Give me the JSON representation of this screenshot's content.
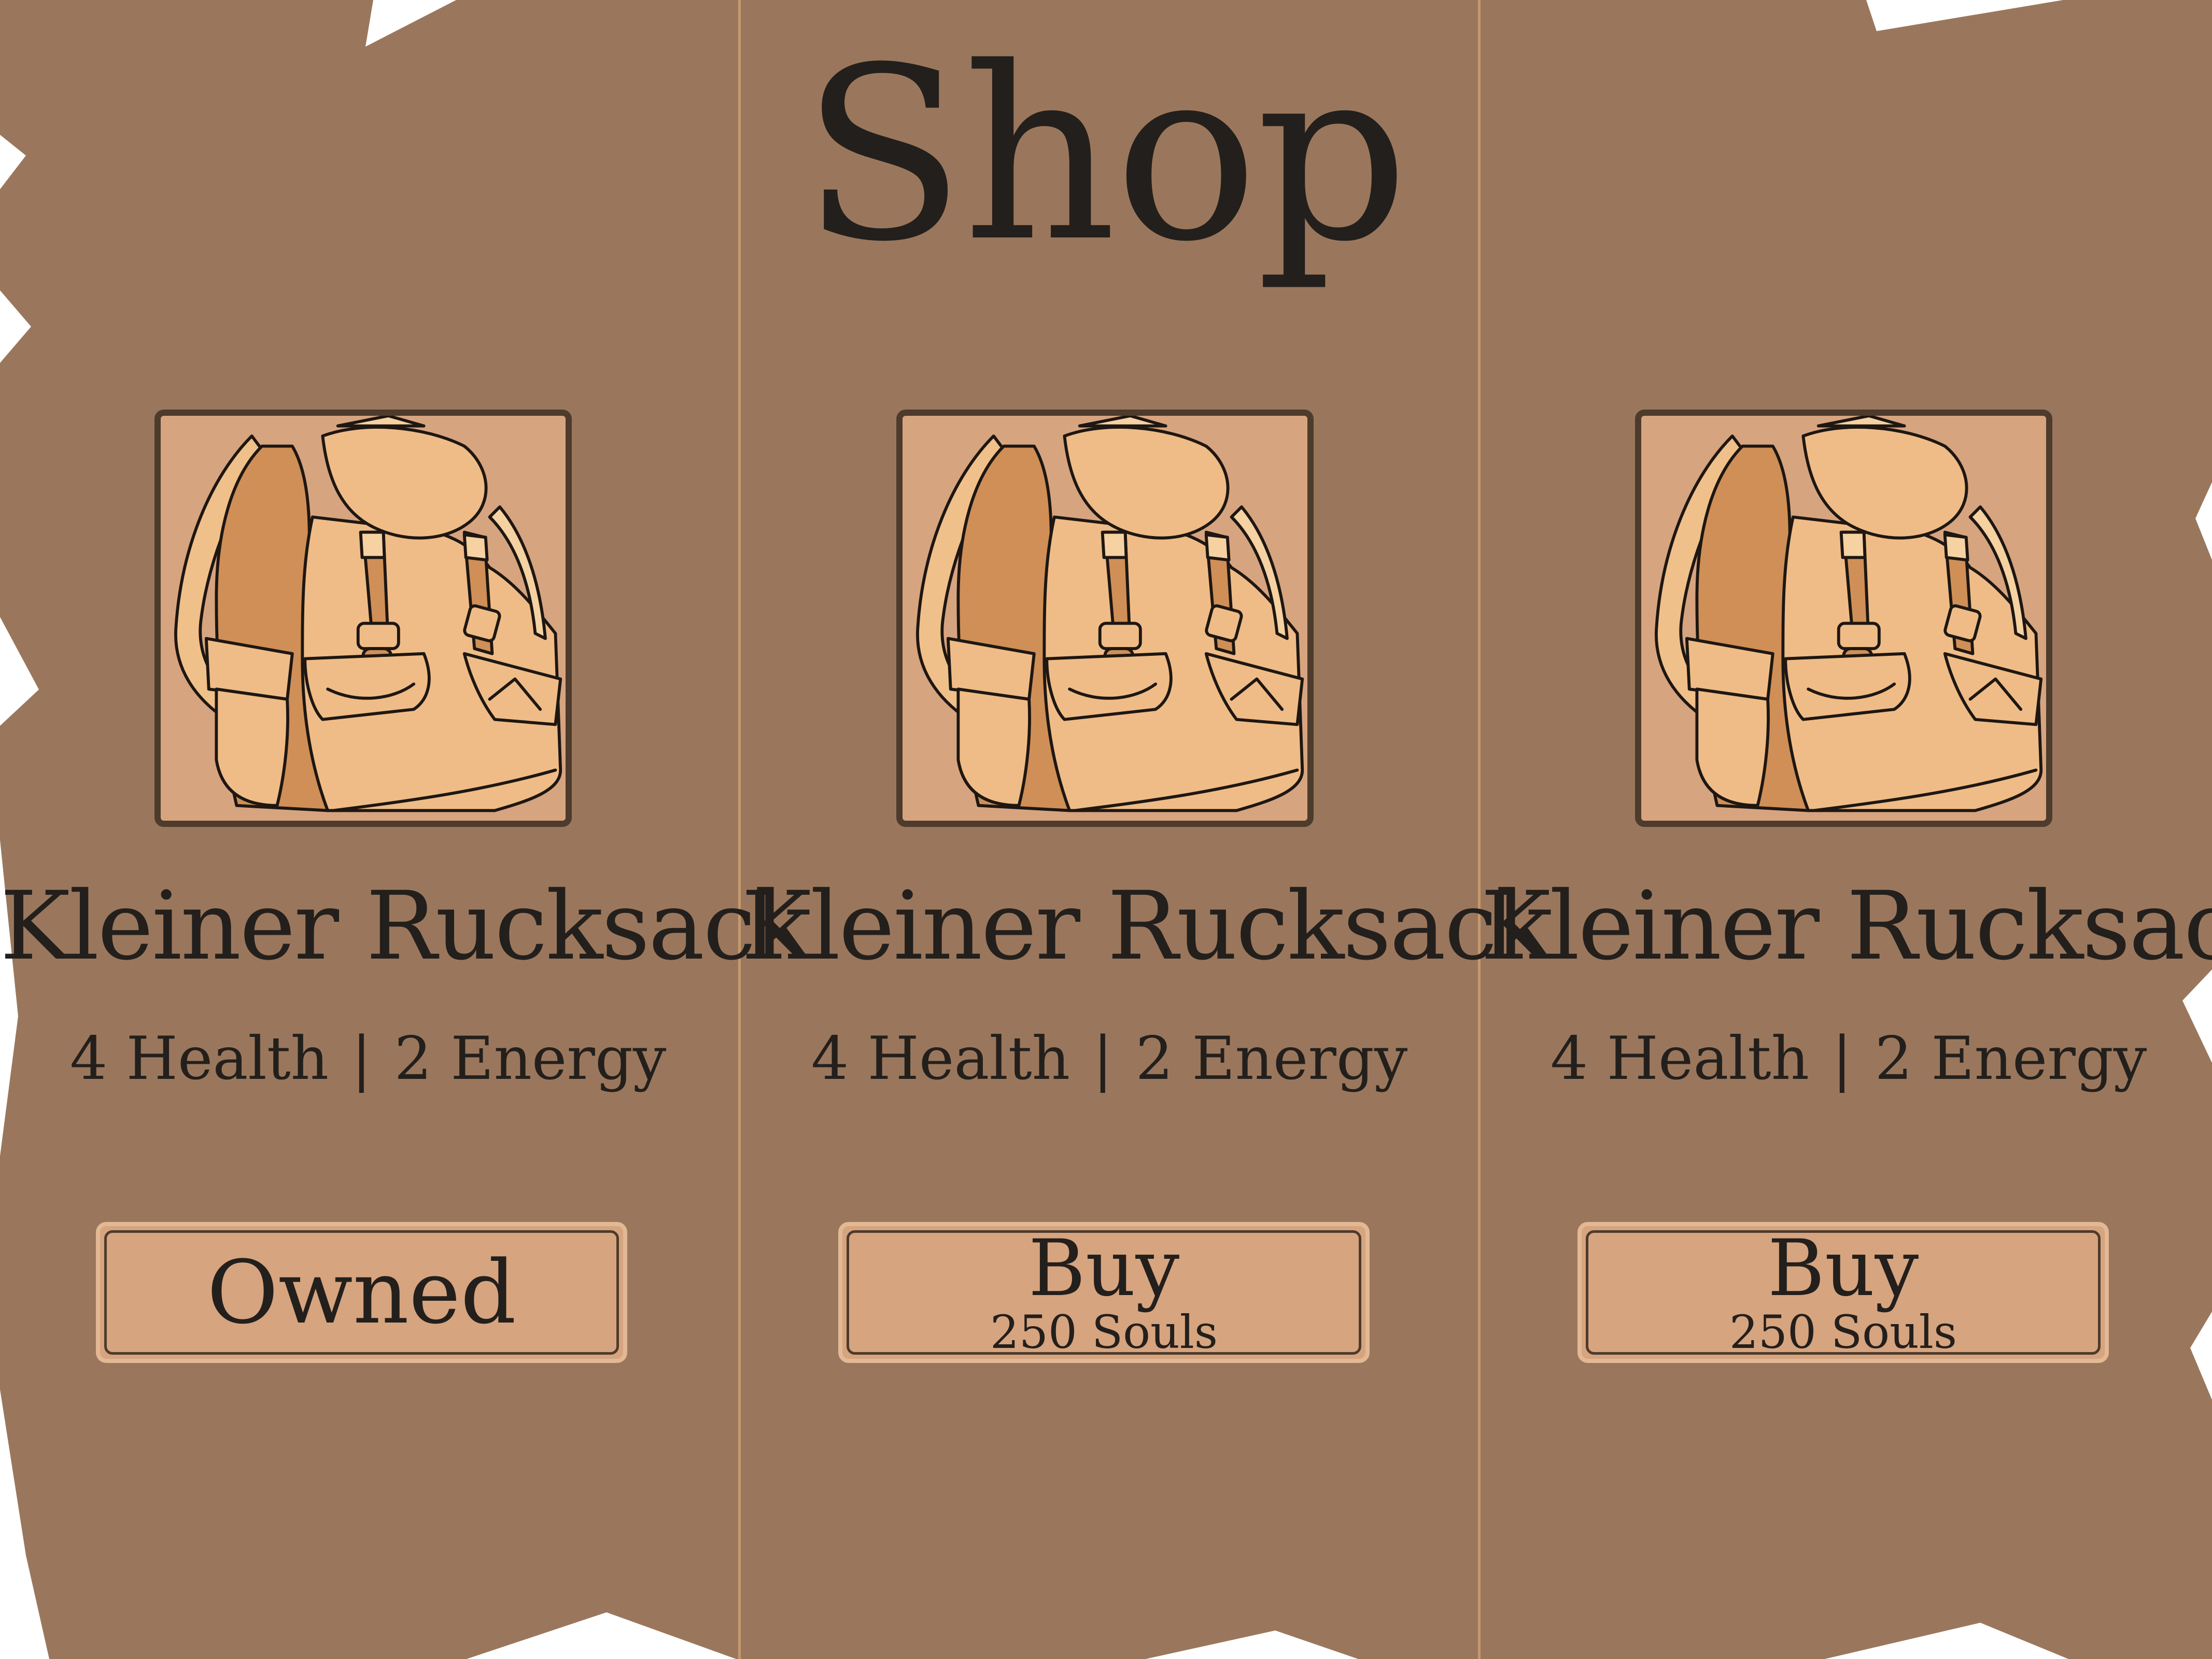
{
  "shop": {
    "title": "Shop",
    "colors": {
      "panel": "#9a775c",
      "divider": "#c5996f",
      "image_bg": "#d7a480",
      "frame": "#4d3b2c",
      "button": "#d6a47f",
      "text": "#231f1c"
    },
    "items": [
      {
        "name": "Kleiner Rucksack",
        "icon": "backpack-icon",
        "health": "4 Health",
        "separator": "|",
        "energy": "2 Energy",
        "button_label": "Owned",
        "button_price": ""
      },
      {
        "name": "Kleiner Rucksack",
        "icon": "backpack-icon",
        "health": "4 Health",
        "separator": "|",
        "energy": "2 Energy",
        "button_label": "Buy",
        "button_price": "250 Souls"
      },
      {
        "name": "Kleiner Rucksack",
        "icon": "backpack-icon",
        "health": "4 Health",
        "separator": "|",
        "energy": "2 Energy",
        "button_label": "Buy",
        "button_price": "250 Souls"
      }
    ]
  }
}
